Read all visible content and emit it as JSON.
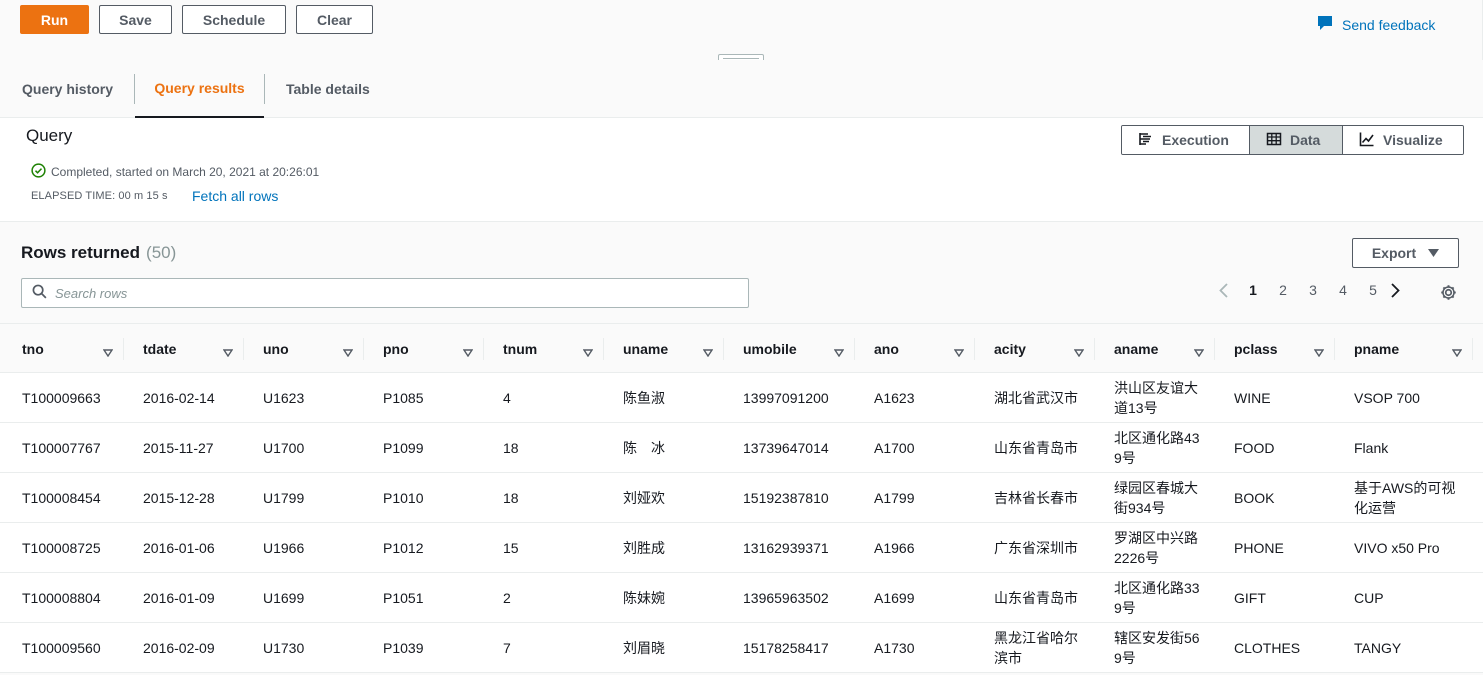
{
  "toolbar": {
    "run_label": "Run",
    "save_label": "Save",
    "schedule_label": "Schedule",
    "clear_label": "Clear",
    "feedback_label": "Send feedback"
  },
  "tabs": [
    {
      "label": "Query history"
    },
    {
      "label": "Query results",
      "active": true
    },
    {
      "label": "Table details"
    }
  ],
  "query": {
    "title": "Query",
    "status": "Completed, started on March 20, 2021 at 20:26:01",
    "elapsed": "ELAPSED TIME: 00 m 15 s",
    "fetch_all": "Fetch all rows"
  },
  "views": {
    "execution": "Execution",
    "data": "Data",
    "visualize": "Visualize"
  },
  "results": {
    "title": "Rows returned",
    "count": "(50)",
    "export_label": "Export",
    "search_placeholder": "Search rows",
    "pages": [
      "1",
      "2",
      "3",
      "4",
      "5"
    ],
    "current_page": "1"
  },
  "table": {
    "columns": [
      "tno",
      "tdate",
      "uno",
      "pno",
      "tnum",
      "uname",
      "umobile",
      "ano",
      "acity",
      "aname",
      "pclass",
      "pname"
    ],
    "rows": [
      [
        "T100009663",
        "2016-02-14",
        "U1623",
        "P1085",
        "4",
        "陈鱼淑",
        "13997091200",
        "A1623",
        "湖北省武汉市",
        "洪山区友谊大道13号",
        "WINE",
        "VSOP 700"
      ],
      [
        "T100007767",
        "2015-11-27",
        "U1700",
        "P1099",
        "18",
        "陈　冰",
        "13739647014",
        "A1700",
        "山东省青岛市",
        "北区通化路439号",
        "FOOD",
        "Flank"
      ],
      [
        "T100008454",
        "2015-12-28",
        "U1799",
        "P1010",
        "18",
        "刘娅欢",
        "15192387810",
        "A1799",
        "吉林省长春市",
        "绿园区春城大街934号",
        "BOOK",
        "基于AWS的可视化运营"
      ],
      [
        "T100008725",
        "2016-01-06",
        "U1966",
        "P1012",
        "15",
        "刘胜成",
        "13162939371",
        "A1966",
        "广东省深圳市",
        "罗湖区中兴路2226号",
        "PHONE",
        "VIVO x50 Pro"
      ],
      [
        "T100008804",
        "2016-01-09",
        "U1699",
        "P1051",
        "2",
        "陈妹婉",
        "13965963502",
        "A1699",
        "山东省青岛市",
        "北区通化路339号",
        "GIFT",
        "CUP"
      ],
      [
        "T100009560",
        "2016-02-09",
        "U1730",
        "P1039",
        "7",
        "刘眉晓",
        "15178258417",
        "A1730",
        "黑龙江省哈尔滨市",
        "辖区安发街569号",
        "CLOTHES",
        "TANGY"
      ]
    ]
  },
  "colors": {
    "accent": "#ec7211",
    "link": "#0073bb",
    "success": "#1d8102"
  }
}
